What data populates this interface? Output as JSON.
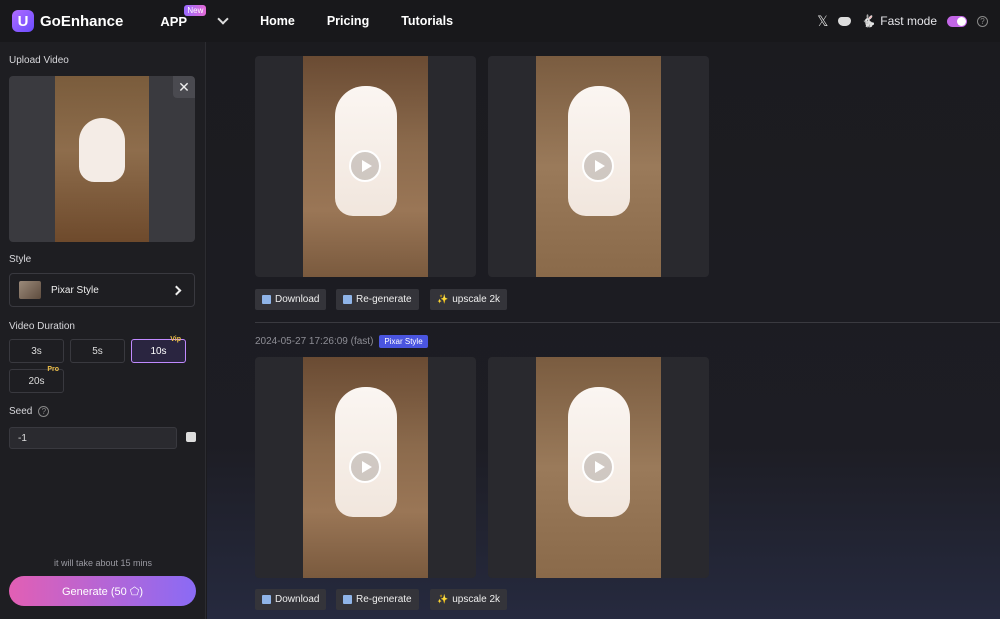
{
  "header": {
    "brand": "GoEnhance",
    "nav": {
      "app": "APP",
      "app_badge": "New",
      "home": "Home",
      "pricing": "Pricing",
      "tutorials": "Tutorials"
    },
    "fast_mode_label": "Fast mode",
    "fast_mode_on": true
  },
  "sidebar": {
    "upload_label": "Upload Video",
    "style_label": "Style",
    "style_value": "Pixar Style",
    "duration_label": "Video Duration",
    "durations": [
      {
        "label": "3s",
        "tier": ""
      },
      {
        "label": "5s",
        "tier": ""
      },
      {
        "label": "10s",
        "tier": "Vip",
        "selected": true
      },
      {
        "label": "20s",
        "tier": "Pro"
      }
    ],
    "seed_label": "Seed",
    "seed_value": "-1",
    "eta": "it will take about 15 mins",
    "generate_label": "Generate (50 ⬠)"
  },
  "results": [
    {
      "actions": {
        "download": "Download",
        "regenerate": "Re-generate",
        "upscale": "upscale 2k"
      }
    },
    {
      "timestamp": "2024-05-27 17:26:09 (fast)",
      "style_badge": "Pixar Style",
      "actions": {
        "download": "Download",
        "regenerate": "Re-generate",
        "upscale": "upscale 2k"
      }
    }
  ]
}
